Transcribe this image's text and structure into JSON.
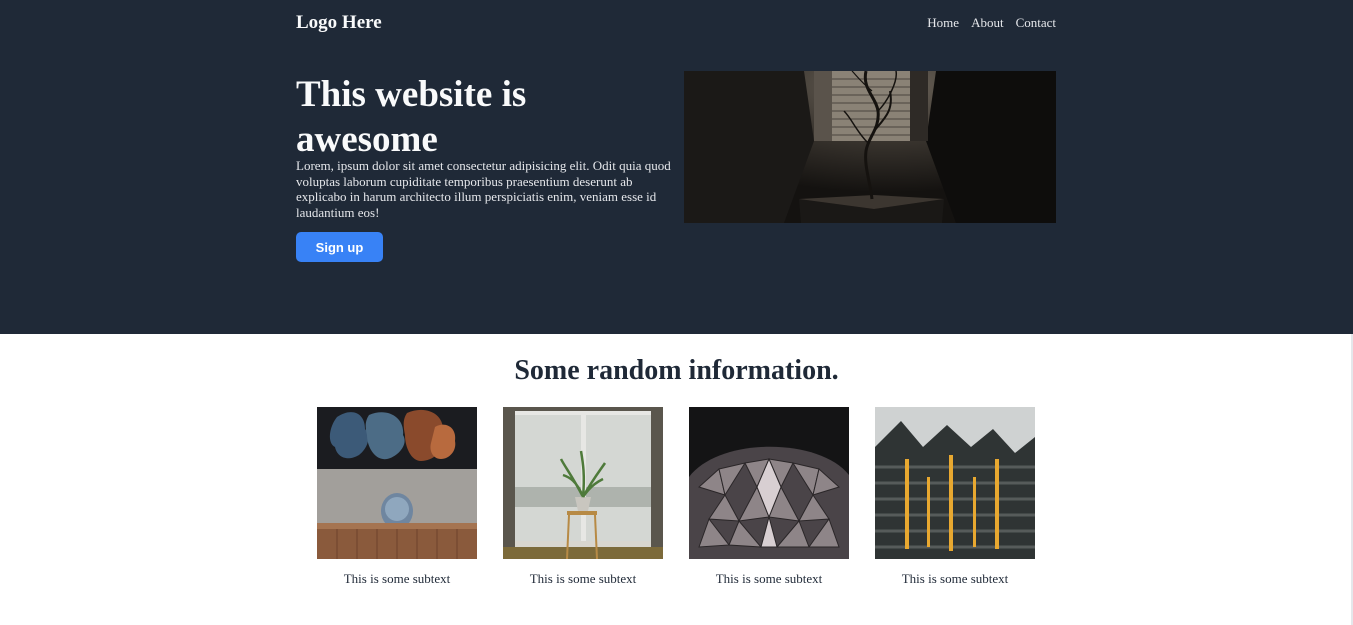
{
  "header": {
    "logo": "Logo Here",
    "nav": [
      "Home",
      "About",
      "Contact"
    ]
  },
  "hero": {
    "title": "This website is awesome",
    "text": "Lorem, ipsum dolor sit amet consectetur adipisicing elit. Odit quia quod voluptas laborum cupiditate temporibus praesentium deserunt ab explicabo in harum architecto illum perspiciatis enim, veniam esse id laudantium eos!",
    "button": "Sign up"
  },
  "info": {
    "title": "Some random information.",
    "cards": [
      {
        "caption": "This is some subtext"
      },
      {
        "caption": "This is some subtext"
      },
      {
        "caption": "This is some subtext"
      },
      {
        "caption": "This is some subtext"
      }
    ]
  },
  "colors": {
    "hero_bg": "#1f2937",
    "accent": "#3882f6"
  }
}
